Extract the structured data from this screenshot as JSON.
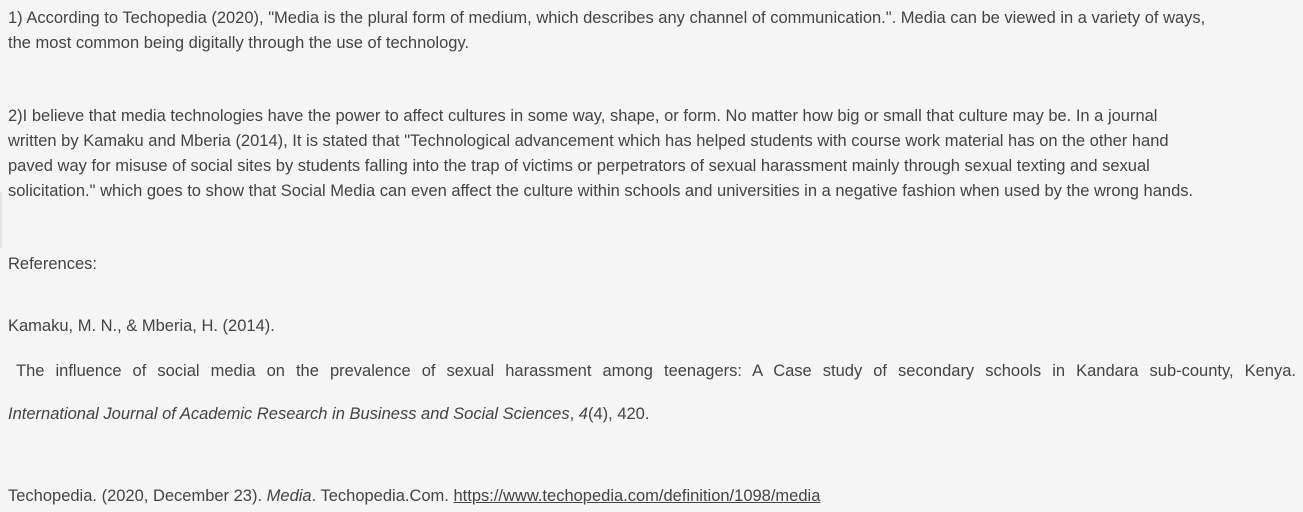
{
  "paragraph1": {
    "line1": "1) According to Techopedia (2020), \"Media is the plural form of medium, which describes any channel of communication.\". Media can be viewed in a variety of ways,",
    "line2": "the most common being digitally through the use of technology."
  },
  "paragraph2": {
    "line1": "2)I believe that media technologies have the power to affect cultures in some way, shape, or form. No matter how big or small that culture may be. In a journal",
    "line2": "written by Kamaku and Mberia (2014), It is stated that \"Technological advancement which has helped students with course work material has on the other hand",
    "line3": "paved way for misuse of social sites by students falling into the trap of victims or perpetrators of sexual harassment mainly through sexual texting and sexual",
    "line4": "solicitation.\" which goes to show that Social Media can even affect the culture within schools and universities in a negative fashion when used by the wrong hands."
  },
  "references_heading": "References:",
  "reference1": {
    "authors": "Kamaku, M. N., & Mberia, H. (2014).",
    "title": "The influence of social media on the prevalence of sexual harassment among teenagers: A Case study of  secondary schools in Kandara sub-county, Kenya.",
    "journal": "International Journal of Academic Research in Business and Social Sciences",
    "sep1": ", ",
    "volume": "4",
    "issue_pages": "(4), 420."
  },
  "reference2": {
    "prefix": "Techopedia. (2020, December 23). ",
    "title": "Media",
    "middle": ". Techopedia.Com. ",
    "url": "https://www.techopedia.com/definition/1098/media"
  }
}
